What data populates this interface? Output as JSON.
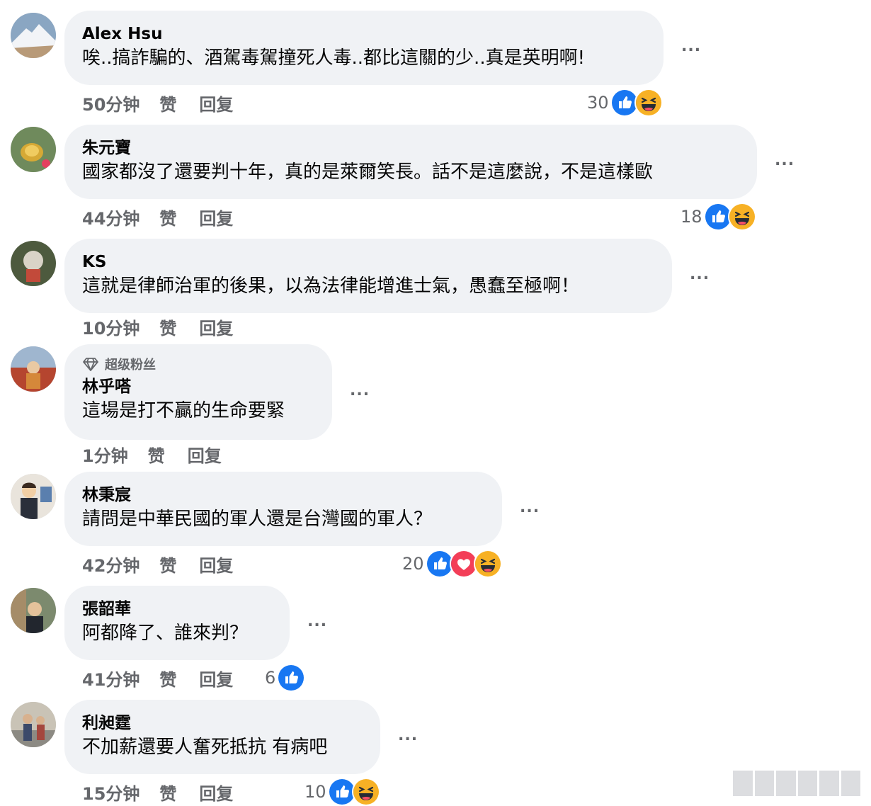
{
  "colors": {
    "bubble": "#f0f2f5",
    "meta": "#65676b",
    "like_blue": "#1877f2",
    "love_red": "#f33e58",
    "haha_yellow": "#f7b125"
  },
  "labels": {
    "like": "赞",
    "reply": "回复",
    "more": "..."
  },
  "comments": [
    {
      "author": "Alex Hsu",
      "text": "唉..搞詐騙的、酒駕毒駕撞死人毒..都比這關的少..真是英明啊!",
      "time": "50分钟",
      "reactions": {
        "count": "30",
        "icons": [
          "like-icon",
          "haha-icon"
        ]
      }
    },
    {
      "author": "朱元寶",
      "text": "國家都沒了還要判十年，真的是萊爾笑長。話不是這麼說，不是這樣歐",
      "time": "44分钟",
      "reactions": {
        "count": "18",
        "icons": [
          "like-icon",
          "haha-icon"
        ]
      }
    },
    {
      "author": "KS",
      "text": "這就是律師治軍的後果，以為法律能增進士氣，愚蠢至極啊！",
      "time": "10分钟"
    },
    {
      "author": "林乎嗒",
      "badge": "超级粉丝",
      "text": "這場是打不贏的生命要緊",
      "time": "1分钟"
    },
    {
      "author": "林秉宸",
      "text": "請問是中華民國的軍人還是台灣國的軍人？",
      "time": "42分钟",
      "reactions": {
        "count": "20",
        "icons": [
          "like-icon",
          "love-icon",
          "haha-icon"
        ]
      }
    },
    {
      "author": "張韶華",
      "text": "阿都降了、誰來判？",
      "time": "41分钟",
      "reactions": {
        "count": "6",
        "icons": [
          "like-icon"
        ]
      }
    },
    {
      "author": "利昶霆",
      "text": "不加薪還要人奮死抵抗 有病吧",
      "time": "15分钟",
      "reactions": {
        "count": "10",
        "icons": [
          "like-icon",
          "haha-icon"
        ]
      }
    }
  ]
}
